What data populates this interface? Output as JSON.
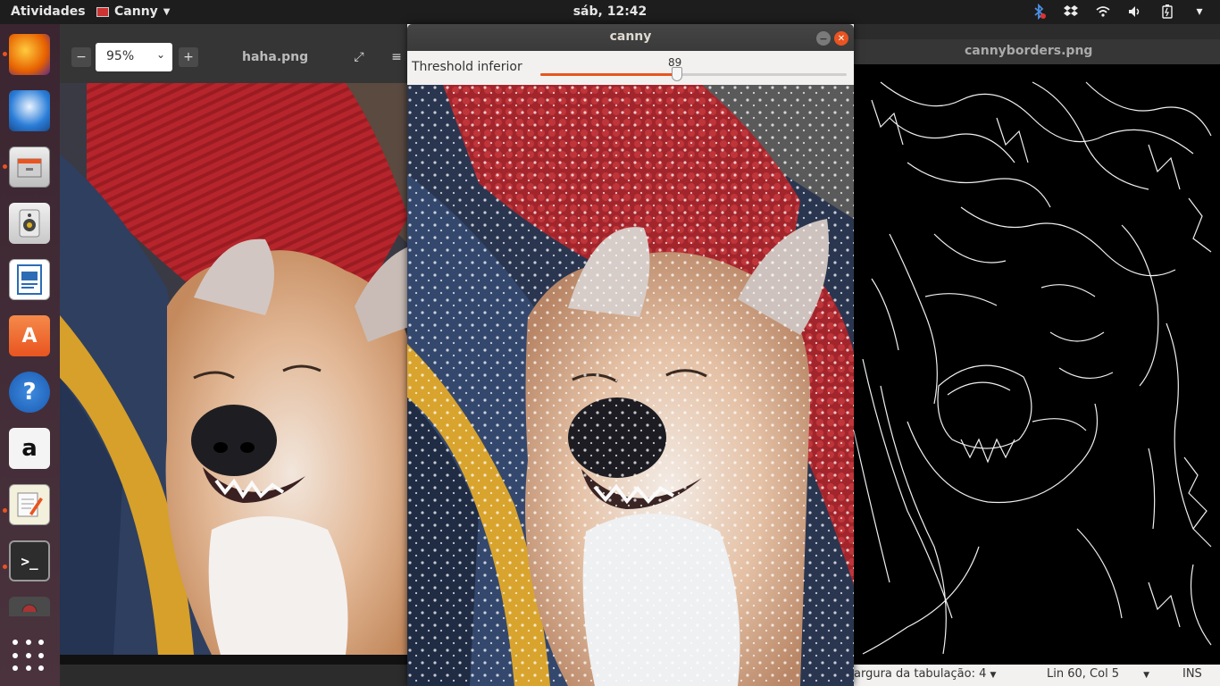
{
  "topbar": {
    "activities": "Atividades",
    "app_name": "Canny",
    "clock": "sáb, 12:42",
    "tray_icons": [
      "bluetooth-icon",
      "dropbox-icon",
      "wifi-icon",
      "volume-icon",
      "battery-icon",
      "power-menu-icon"
    ]
  },
  "dock": {
    "items": [
      "firefox-icon",
      "thunderbird-icon",
      "files-icon",
      "rhythmbox-icon",
      "libreoffice-writer-icon",
      "ubuntu-software-icon",
      "help-icon",
      "amazon-icon",
      "text-editor-icon",
      "terminal-icon",
      "screenshot-icon"
    ],
    "apps_grid": "show-applications-icon"
  },
  "viewer": {
    "zoom": "95%",
    "filename": "haha.png"
  },
  "canny": {
    "title": "canny",
    "trackbar_label": "Threshold inferior",
    "trackbar_value": "89",
    "trackbar_fraction": 0.445
  },
  "edges": {
    "filename": "cannyborders.png",
    "status": {
      "tab_width": "argura da tabulação: 4",
      "position": "Lin 60, Col 5",
      "mode": "INS"
    }
  },
  "colors": {
    "accent": "#e95420",
    "topbar": "#1d1d1d",
    "dock": "#3d2a34"
  }
}
